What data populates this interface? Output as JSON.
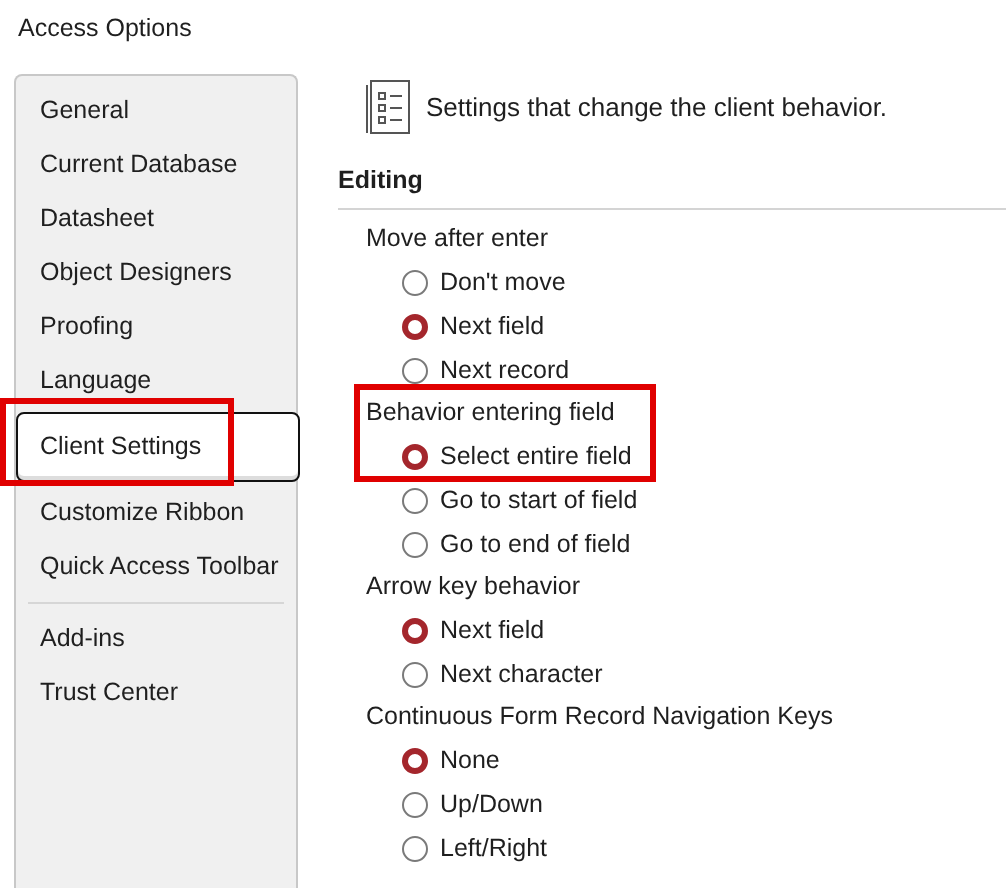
{
  "window": {
    "title": "Access Options"
  },
  "sidebar": {
    "items": [
      {
        "label": "General",
        "selected": false
      },
      {
        "label": "Current Database",
        "selected": false
      },
      {
        "label": "Datasheet",
        "selected": false
      },
      {
        "label": "Object Designers",
        "selected": false
      },
      {
        "label": "Proofing",
        "selected": false
      },
      {
        "label": "Language",
        "selected": false
      },
      {
        "label": "Client Settings",
        "selected": true,
        "highlighted": true
      },
      {
        "label": "Customize Ribbon",
        "selected": false
      },
      {
        "label": "Quick Access Toolbar",
        "selected": false,
        "divider_after": true
      },
      {
        "label": "Add-ins",
        "selected": false
      },
      {
        "label": "Trust Center",
        "selected": false
      }
    ]
  },
  "header": {
    "text": "Settings that change the client behavior."
  },
  "section": {
    "title": "Editing",
    "groups": [
      {
        "label": "Move after enter",
        "options": [
          {
            "label": "Don't move",
            "selected": false
          },
          {
            "label": "Next field",
            "selected": true
          },
          {
            "label": "Next record",
            "selected": false
          }
        ]
      },
      {
        "label": "Behavior entering field",
        "highlighted": true,
        "options": [
          {
            "label": "Select entire field",
            "selected": true
          },
          {
            "label": "Go to start of field",
            "selected": false
          },
          {
            "label": "Go to end of field",
            "selected": false
          }
        ]
      },
      {
        "label": "Arrow key behavior",
        "options": [
          {
            "label": "Next field",
            "selected": true
          },
          {
            "label": "Next character",
            "selected": false
          }
        ]
      },
      {
        "label": "Continuous Form Record Navigation Keys",
        "options": [
          {
            "label": "None",
            "selected": true
          },
          {
            "label": "Up/Down",
            "selected": false
          },
          {
            "label": "Left/Right",
            "selected": false
          }
        ]
      }
    ]
  }
}
